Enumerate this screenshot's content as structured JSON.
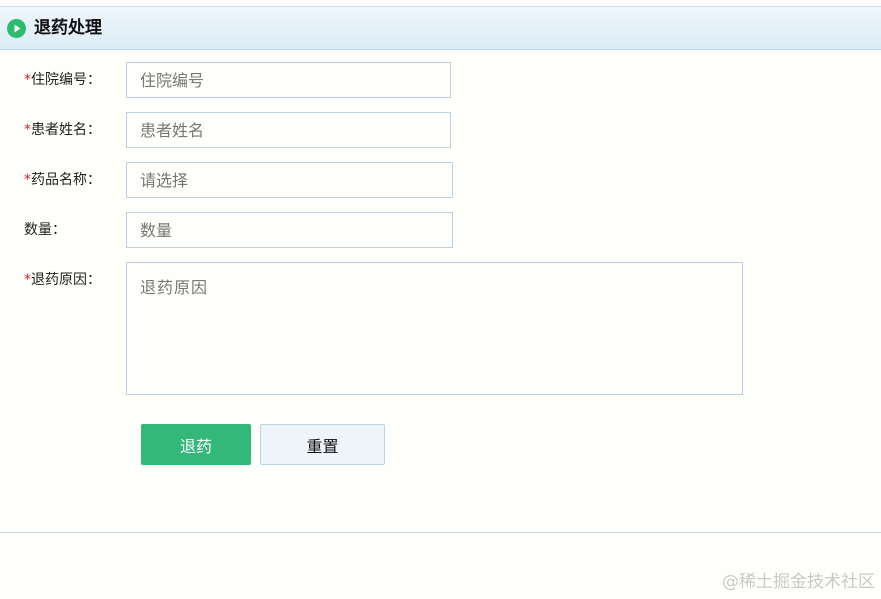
{
  "header": {
    "title": "退药处理",
    "icon": "play-circle-icon"
  },
  "form": {
    "hospital_no": {
      "required_mark": "*",
      "label": "住院编号：",
      "placeholder": "住院编号",
      "value": ""
    },
    "patient_name": {
      "required_mark": "*",
      "label": "患者姓名：",
      "placeholder": "患者姓名",
      "value": ""
    },
    "drug_name": {
      "required_mark": "*",
      "label": "药品名称：",
      "placeholder": "请选择",
      "value": ""
    },
    "quantity": {
      "label": "数量：",
      "placeholder": "数量",
      "value": ""
    },
    "reason": {
      "required_mark": "*",
      "label": "退药原因：",
      "placeholder": "退药原因",
      "value": ""
    }
  },
  "buttons": {
    "submit_label": "退药",
    "reset_label": "重置"
  },
  "watermark": "@稀土掘金技术社区",
  "colors": {
    "accent_green": "#33b87a",
    "required_red": "#e02020",
    "border_blue": "#b9d1e2"
  }
}
